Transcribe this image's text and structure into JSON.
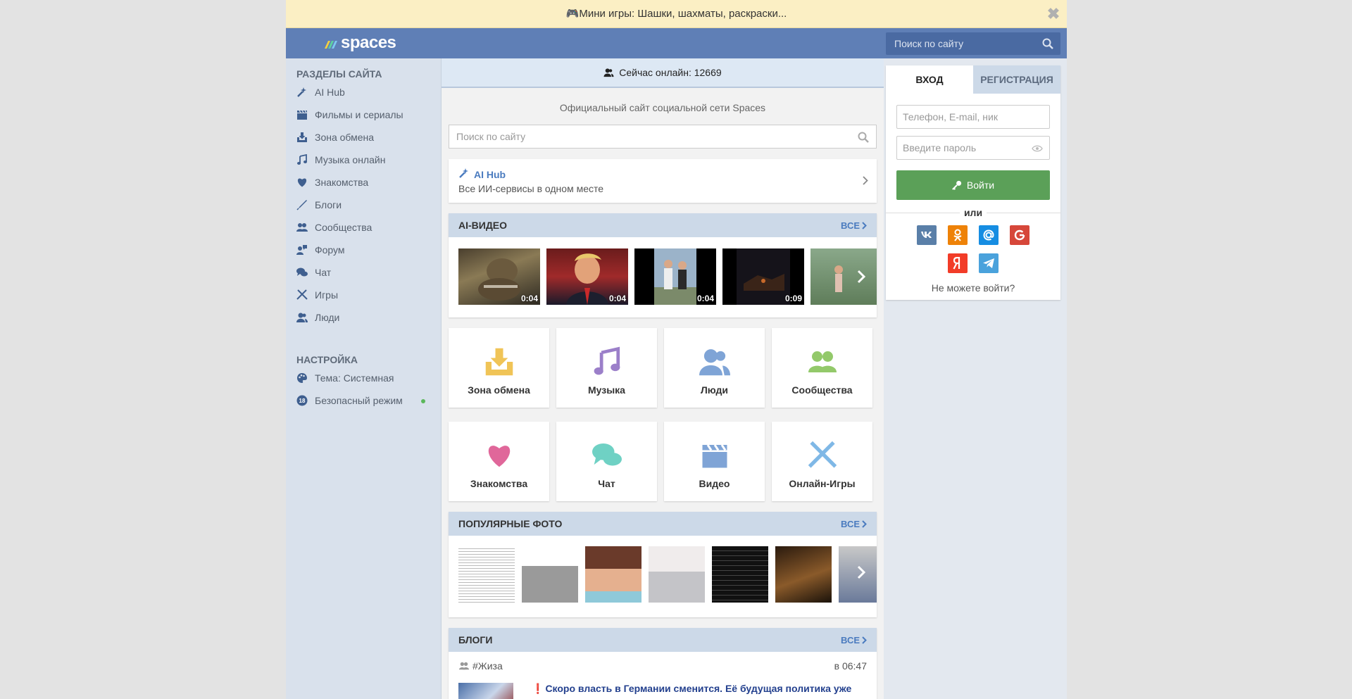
{
  "banner": {
    "text": "🎮Мини игры: Шашки, шахматы, раскраски...",
    "close": "✖"
  },
  "header": {
    "logo_text": "spaces",
    "search_placeholder": "Поиск по сайту"
  },
  "sidebar": {
    "sections_title": "Разделы сайта",
    "items": [
      {
        "label": "AI Hub",
        "icon": "magic-wand-icon"
      },
      {
        "label": "Фильмы и сериалы",
        "icon": "film-icon"
      },
      {
        "label": "Зона обмена",
        "icon": "download-box-icon"
      },
      {
        "label": "Музыка онлайн",
        "icon": "music-note-icon"
      },
      {
        "label": "Знакомства",
        "icon": "heart-icon"
      },
      {
        "label": "Блоги",
        "icon": "pen-icon"
      },
      {
        "label": "Сообщества",
        "icon": "community-icon"
      },
      {
        "label": "Форум",
        "icon": "forum-icon"
      },
      {
        "label": "Чат",
        "icon": "chat-icon"
      },
      {
        "label": "Игры",
        "icon": "swords-icon"
      },
      {
        "label": "Люди",
        "icon": "people-icon"
      }
    ],
    "settings_title": "Настройка",
    "settings": [
      {
        "label": "Тема: Системная",
        "icon": "palette-icon"
      },
      {
        "label": "Безопасный режим",
        "icon": "age-18-icon",
        "badge": "18"
      }
    ]
  },
  "center": {
    "online_text": "Сейчас онлайн: 12669",
    "official_text": "Официальный сайт социальной сети Spaces",
    "search_placeholder": "Поиск по сайту",
    "aihub": {
      "title": "AI Hub",
      "desc": "Все ИИ-сервисы в одном месте"
    },
    "ai_video": {
      "title": "AI-видео",
      "all": "Все",
      "videos": [
        {
          "duration": "0:04"
        },
        {
          "duration": "0:04"
        },
        {
          "duration": "0:04"
        },
        {
          "duration": "0:09"
        }
      ]
    },
    "tiles": [
      {
        "label": "Зона обмена",
        "icon": "download-box-icon",
        "color": "#f0c457"
      },
      {
        "label": "Музыка",
        "icon": "music-note-icon",
        "color": "#9b7fc9"
      },
      {
        "label": "Люди",
        "icon": "people-icon",
        "color": "#7fa4d6"
      },
      {
        "label": "Сообщества",
        "icon": "community-icon",
        "color": "#93c96a"
      },
      {
        "label": "Знакомства",
        "icon": "heart-icon",
        "color": "#e0679a"
      },
      {
        "label": "Чат",
        "icon": "chat-icon",
        "color": "#6fd1c4"
      },
      {
        "label": "Видео",
        "icon": "film-icon",
        "color": "#7fa4d6"
      },
      {
        "label": "Онлайн-Игры",
        "icon": "swords-icon",
        "color": "#7fb8e6"
      }
    ],
    "photos": {
      "title": "Популярные фото",
      "all": "Все"
    },
    "blogs": {
      "title": "Блоги",
      "all": "Все",
      "post": {
        "tag": "#Жиза",
        "time": "в 06:47",
        "mark": "❗",
        "title": "Скоро власть в Германии сменится. Её будущая политика уже"
      }
    }
  },
  "auth": {
    "tab_login": "Вход",
    "tab_register": "Регистрация",
    "login_placeholder": "Телефон, E-mail, ник",
    "password_placeholder": "Введите пароль",
    "login_button": "Войти",
    "or": "или",
    "cant_login": "Не можете войти?",
    "socials": [
      {
        "name": "vk",
        "label": "VK",
        "color": "#5a7fa8"
      },
      {
        "name": "ok",
        "label": "ОК",
        "color": "#ee8208"
      },
      {
        "name": "mailru",
        "label": "@",
        "color": "#168de2"
      },
      {
        "name": "google",
        "label": "G",
        "color": "#d6473a"
      },
      {
        "name": "yandex",
        "label": "Я",
        "color": "#f23c28"
      },
      {
        "name": "telegram",
        "label": "TG",
        "color": "#4aa2dc"
      }
    ]
  }
}
